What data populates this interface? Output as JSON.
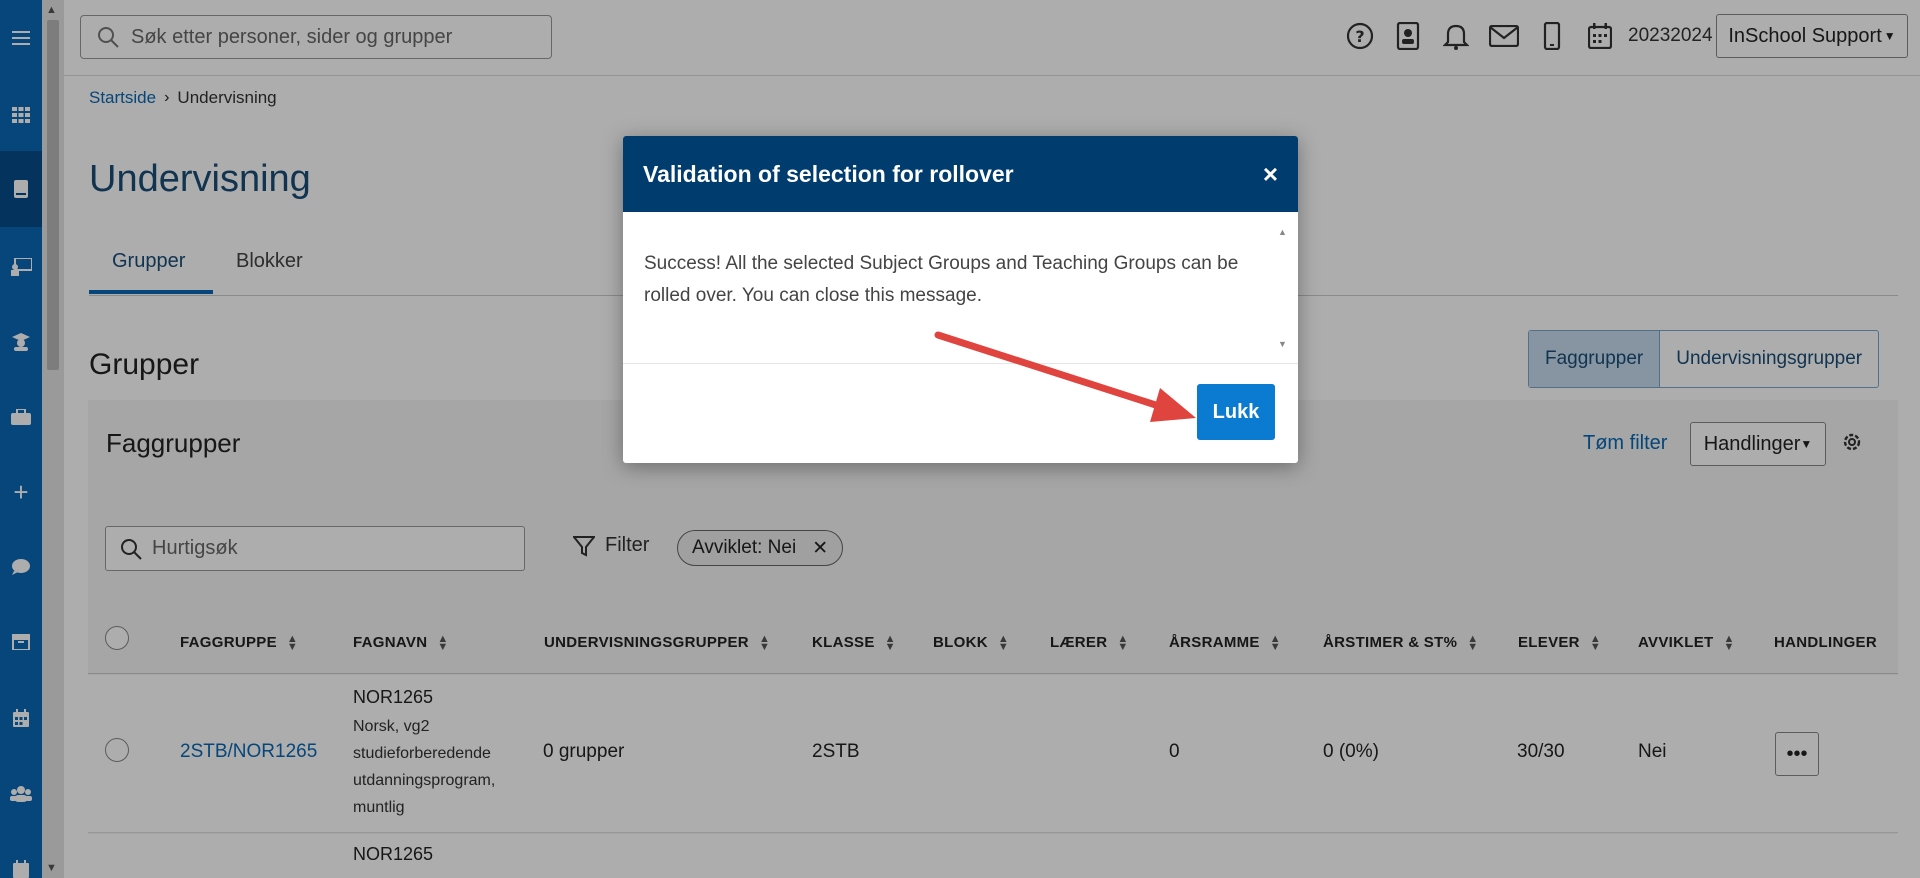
{
  "sidebar": {
    "items": [
      "menu-icon",
      "apps-icon",
      "book-icon",
      "teacher-icon",
      "student-icon",
      "briefcase-icon",
      "plus-icon",
      "chat-icon",
      "archive-icon",
      "calendar-icon",
      "people-icon",
      "calendar-check-icon"
    ]
  },
  "header": {
    "search_placeholder": "Søk etter personer, sider og grupper",
    "year": "20232024",
    "user_menu": "InSchool Support"
  },
  "breadcrumb": {
    "home": "Startside",
    "current": "Undervisning"
  },
  "page": {
    "title": "Undervisning",
    "tabs": [
      {
        "label": "Grupper"
      },
      {
        "label": "Blokker"
      }
    ],
    "section_title": "Grupper",
    "segment": [
      "Faggrupper",
      "Undervisningsgrupper"
    ]
  },
  "panel": {
    "title": "Faggrupper",
    "clear_filter": "Tøm filter",
    "actions": "Handlinger",
    "quick_search_placeholder": "Hurtigsøk",
    "filter_label": "Filter",
    "chip": "Avviklet: Nei"
  },
  "table": {
    "columns": [
      "FAGGRUPPE",
      "FAGNAVN",
      "UNDERVISNINGSGRUPPER",
      "KLASSE",
      "BLOKK",
      "LÆRER",
      "ÅRSRAMME",
      "ÅRSTIMER & ST%",
      "ELEVER",
      "AVVIKLET",
      "HANDLINGER"
    ],
    "rows": [
      {
        "faggruppe": "2STB/NOR1265",
        "fagkode": "NOR1265",
        "fagnavn_lines": [
          "Norsk, vg2",
          "studieforberedende",
          "utdanningsprogram,",
          "muntlig"
        ],
        "undervisningsgrupper": "0 grupper",
        "klasse": "2STB",
        "aarsramme": "0",
        "aarstimer": "0 (0%)",
        "elever": "30/30",
        "avviklet": "Nei"
      },
      {
        "fagkode": "NOR1265"
      }
    ]
  },
  "modal": {
    "title": "Validation of selection for rollover",
    "message": "Success! All the selected Subject Groups and Teaching Groups can be rolled over. You can close this message.",
    "close_button": "Lukk",
    "close_icon": "×"
  },
  "colors": {
    "brand": "#0a68b4",
    "modal_header": "#003c6e",
    "annotation_arrow": "#e0443e"
  }
}
